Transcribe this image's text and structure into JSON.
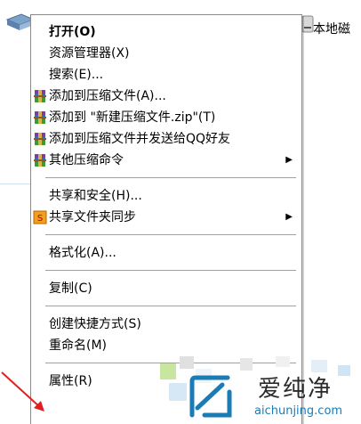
{
  "background": {
    "drive_label_partial": "本地磁",
    "drive_icon": "drive-icon"
  },
  "menu": {
    "groups": [
      [
        {
          "label": "打开(O)",
          "bold": true
        },
        {
          "label": "资源管理器(X)"
        },
        {
          "label": "搜索(E)..."
        },
        {
          "label": "添加到压缩文件(A)...",
          "icon": "winrar-icon"
        },
        {
          "label": "添加到 \"新建压缩文件.zip\"(T)",
          "icon": "winrar-icon"
        },
        {
          "label": "添加到压缩文件并发送给QQ好友",
          "icon": "winrar-icon"
        },
        {
          "label": "其他压缩命令",
          "icon": "winrar-icon",
          "submenu": true
        }
      ],
      [
        {
          "label": "共享和安全(H)..."
        },
        {
          "label": "共享文件夹同步",
          "icon": "sync-icon",
          "submenu": true
        }
      ],
      [
        {
          "label": "格式化(A)..."
        }
      ],
      [
        {
          "label": "复制(C)"
        }
      ],
      [
        {
          "label": "创建快捷方式(S)"
        },
        {
          "label": "重命名(M)"
        }
      ],
      [
        {
          "label": "属性(R)"
        }
      ]
    ]
  },
  "watermark": {
    "title": "爱纯净",
    "url": "aichunjing.com",
    "logo_icon": "aichunjing-logo-icon",
    "accent": "#1b7bb5"
  }
}
